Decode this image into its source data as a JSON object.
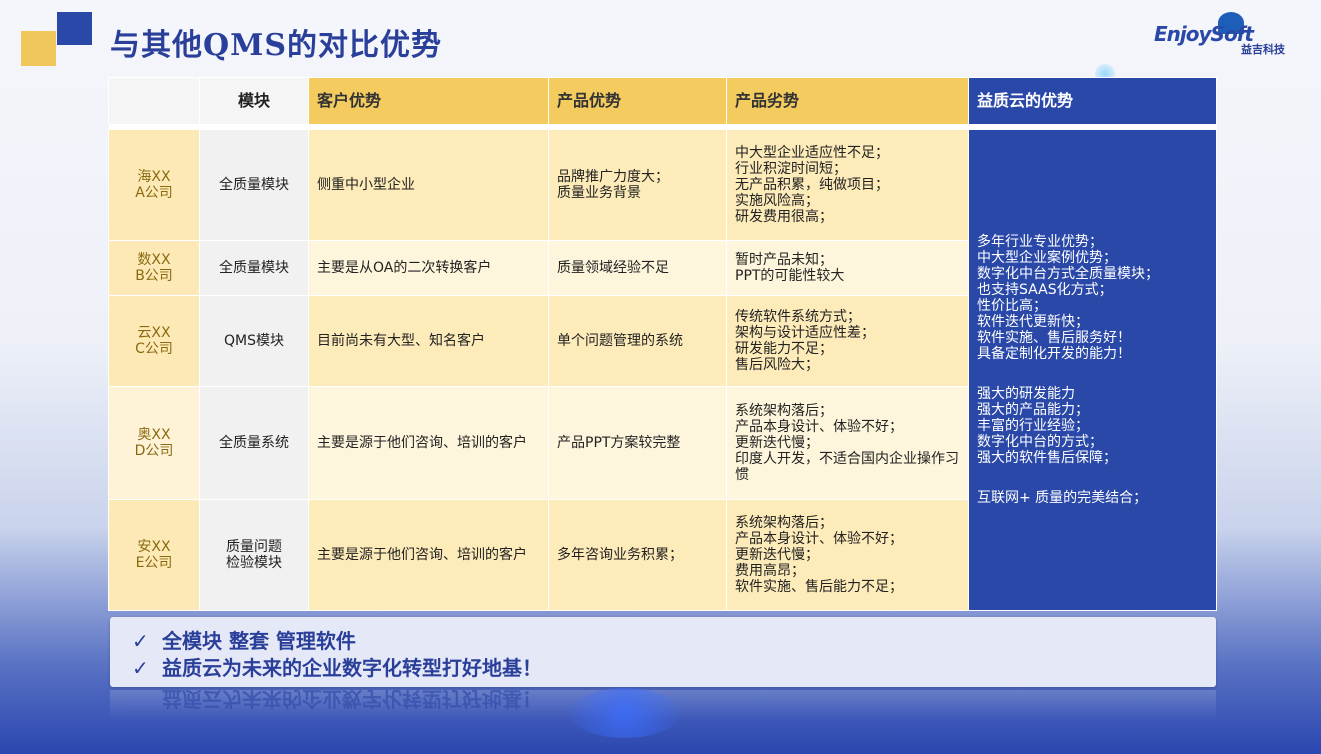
{
  "title": "与其他QMS的对比优势",
  "logo": {
    "brand": "EnjoySoft",
    "sub": "益吉科技"
  },
  "headers": {
    "blank": "",
    "module": "模块",
    "customer": "客户优势",
    "product_adv": "产品优势",
    "product_dis": "产品劣势",
    "ours": "益质云的优势"
  },
  "rows": [
    {
      "company": [
        "海XX",
        "A公司"
      ],
      "module": [
        "全质量模块"
      ],
      "customer": [
        "侧重中小型企业"
      ],
      "product_adv": [
        "品牌推广力度大；",
        "质量业务背景"
      ],
      "product_dis": [
        "中大型企业适应性不足；",
        "行业积淀时间短；",
        "无产品积累，纯做项目；",
        "实施风险高；",
        "研发费用很高；"
      ]
    },
    {
      "company": [
        "数XX",
        "B公司"
      ],
      "module": [
        "全质量模块"
      ],
      "customer": [
        "主要是从OA的二次转换客户"
      ],
      "product_adv": [
        "质量领域经验不足"
      ],
      "product_dis": [
        "暂时产品未知；",
        "PPT的可能性较大"
      ]
    },
    {
      "company": [
        "云XX",
        "C公司"
      ],
      "module": [
        "QMS模块"
      ],
      "customer": [
        "目前尚未有大型、知名客户"
      ],
      "product_adv": [
        "单个问题管理的系统"
      ],
      "product_dis": [
        "传统软件系统方式；",
        "架构与设计适应性差；",
        "研发能力不足；",
        "售后风险大；"
      ]
    },
    {
      "company": [
        "奥XX",
        "D公司"
      ],
      "module": [
        "全质量系统"
      ],
      "customer": [
        "主要是源于他们咨询、培训的客户"
      ],
      "product_adv": [
        "产品PPT方案较完整"
      ],
      "product_dis": [
        "系统架构落后；",
        "产品本身设计、体验不好；",
        "更新迭代慢；",
        "印度人开发，不适合国内企业操作习惯"
      ]
    },
    {
      "company": [
        "安XX",
        "E公司"
      ],
      "module": [
        "质量问题",
        "检验模块"
      ],
      "customer": [
        "主要是源于他们咨询、培训的客户"
      ],
      "product_adv": [
        "多年咨询业务积累；"
      ],
      "product_dis": [
        "系统架构落后；",
        "产品本身设计、体验不好；",
        "更新迭代慢；",
        "费用高昂；",
        "软件实施、售后能力不足；"
      ]
    }
  ],
  "ours_group1": [
    "多年行业专业优势；",
    "中大型企业案例优势；",
    "数字化中台方式全质量模块；",
    "也支持SAAS化方式；",
    "性价比高；",
    "软件迭代更新快；",
    "软件实施、售后服务好！",
    "具备定制化开发的能力！"
  ],
  "ours_group2": [
    "强大的研发能力",
    "强大的产品能力；",
    "丰富的行业经验；",
    "数字化中台的方式；",
    "强大的软件售后保障；"
  ],
  "ours_group3": [
    "互联网+ 质量的完美结合；"
  ],
  "summary": {
    "check": "✓",
    "line1": "全模块  整套  管理软件",
    "line2": "益质云为未来的企业数字化转型打好地基！"
  }
}
